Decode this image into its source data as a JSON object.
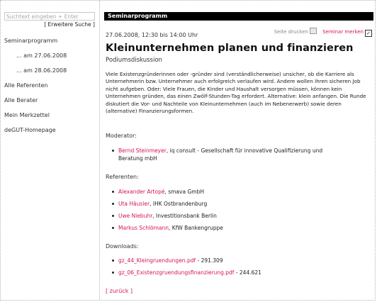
{
  "search": {
    "placeholder": "Suchtext eingeben + Enter",
    "advanced_label": "[ Erweitere Suche ]"
  },
  "sidebar": {
    "items": [
      {
        "label": "Seminarprogramm"
      },
      {
        "label": "... am 27.06.2008"
      },
      {
        "label": "... am 28.06.2008"
      },
      {
        "label": "Alle Referenten"
      },
      {
        "label": "Alle Berater"
      },
      {
        "label": "Mein Merkzettel"
      },
      {
        "label": "deGUT-Homepage"
      }
    ]
  },
  "main": {
    "section_title": "Seminarprogramm",
    "actions": {
      "print_label": "Seite drucken",
      "save_label": "Seminar merken"
    },
    "date_time": "27.06.2008, 12:30 bis 14:00 Uhr",
    "title": "Kleinunternehmen planen und finanzieren",
    "subtitle": "Podiumsdiskussion",
    "description": "Viele Existenzgründerinnen oder -gründer sind (verständlicherweise) unsicher, ob die Karriere als Unternehmerin bzw. Unternehmer auch erfolgreich verlaufen wird. Andere wollen ihren sicheren Job nicht aufgeben. Oder: Viele Frauen, die Kinder und Haushalt versorgen müssen, können kein Unternehmen gründen, das einen Zwölf-Stunden-Tag erfordert. Alternative: klein anfangen. Die Runde diskutiert die Vor- und Nachteile von Kleinunternehmen (auch im Nebenerwerb) sowie deren (alternative) Finanzierungsformen.",
    "moderator_label": "Moderator:",
    "moderator": {
      "name": "Bernd Steinmeyer",
      "org_line1": ", iq consult - Gesellschaft für innovative Qualifizierung und",
      "org_line2": "Beratung mbH"
    },
    "speakers_label": "Referenten:",
    "speakers": [
      {
        "name": "Alexander Artopé",
        "org": ", smava GmbH"
      },
      {
        "name": "Uta Häusler",
        "org": ", IHK Ostbrandenburg"
      },
      {
        "name": "Uwe Niebuhr",
        "org": ", Investitionsbank Berlin"
      },
      {
        "name": "Markus Schlömann",
        "org": ", KfW Bankengruppe"
      }
    ],
    "downloads_label": "Downloads:",
    "downloads": [
      {
        "file": "gz_44_Kleingruendungen.pdf",
        "size": " - 291.309"
      },
      {
        "file": "gz_06_Existenzgruendungsfinanzierung.pdf",
        "size": " - 244.621"
      }
    ],
    "back_label": "[ zurück ]"
  },
  "colors": {
    "accent": "#d4145a",
    "header_bar": "#000000"
  },
  "icons": {
    "print": "printer-icon",
    "save": "checkbox-icon"
  }
}
